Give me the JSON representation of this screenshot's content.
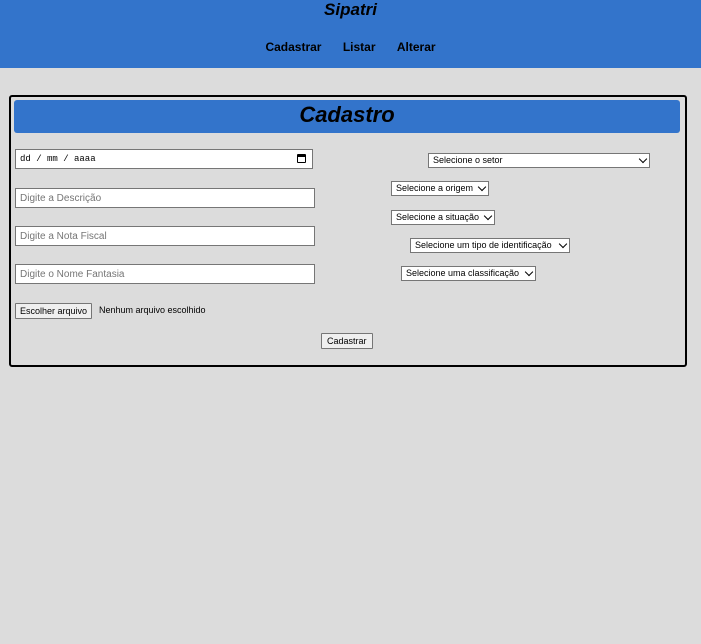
{
  "app": {
    "title": "Sipatri"
  },
  "nav": {
    "items": [
      "Cadastrar",
      "Listar",
      "Alterar"
    ]
  },
  "form": {
    "heading": "Cadastro",
    "date_placeholder": "dd / mm / aaaa",
    "descricao_placeholder": "Digite a Descrição",
    "nota_fiscal_placeholder": "Digite a Nota Fiscal",
    "nome_fantasia_placeholder": "Digite o Nome Fantasia",
    "file_button_label": "Escolher arquivo",
    "file_status": "Nenhum arquivo escolhido",
    "submit_label": "Cadastrar",
    "selects": {
      "setor": "Selecione o setor",
      "origem": "Selecione a origem",
      "situacao": "Selecione a situação",
      "tipo_identificacao": "Selecione um tipo de identificação",
      "classificacao": "Selecione uma classificação"
    }
  },
  "icons": {
    "calendar": "calendar-icon",
    "chevron": "chevron-down-icon"
  },
  "colors": {
    "accent": "#3374cb",
    "background": "#dcdcdc"
  }
}
